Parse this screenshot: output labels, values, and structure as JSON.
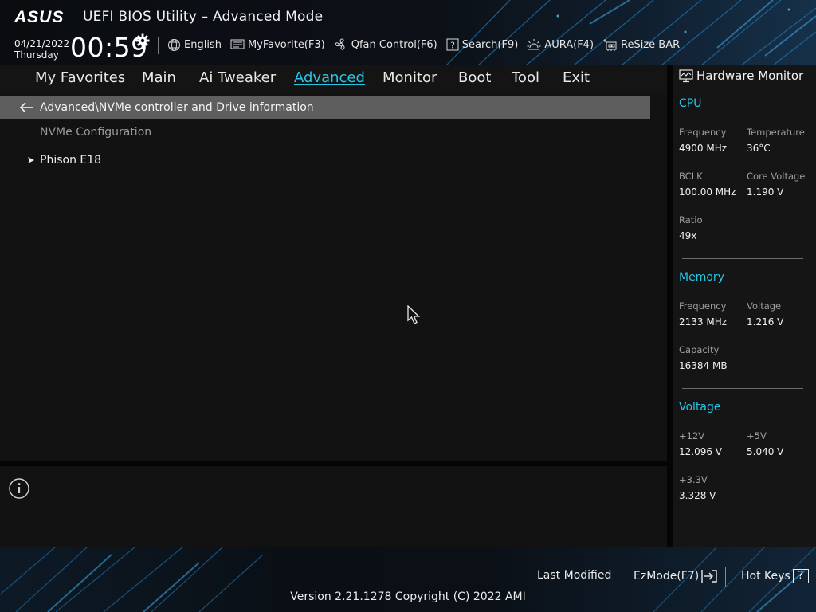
{
  "header": {
    "brand": "ASUS",
    "title": "UEFI BIOS Utility – Advanced Mode",
    "date": "04/21/2022",
    "day": "Thursday",
    "time": "00:59",
    "icons": {
      "settings": "gear-icon"
    }
  },
  "toolbar": {
    "items": [
      {
        "label": "English",
        "icon": "globe-icon"
      },
      {
        "label": "MyFavorite(F3)",
        "icon": "favorite-icon"
      },
      {
        "label": "Qfan Control(F6)",
        "icon": "fan-icon"
      },
      {
        "label": "Search(F9)",
        "icon": "search-help-icon"
      },
      {
        "label": "AURA(F4)",
        "icon": "aura-icon"
      },
      {
        "label": "ReSize BAR",
        "icon": "resize-bar-icon"
      }
    ]
  },
  "menu": {
    "items": [
      "My Favorites",
      "Main",
      "Ai Tweaker",
      "Advanced",
      "Monitor",
      "Boot",
      "Tool",
      "Exit"
    ],
    "active": "Advanced"
  },
  "main": {
    "path": "Advanced\\NVMe controller and Drive information",
    "section_label": "NVMe Configuration",
    "items": [
      {
        "label": "Phison E18"
      }
    ]
  },
  "hardware_monitor": {
    "title": "Hardware Monitor",
    "cpu": {
      "title": "CPU",
      "frequency_label": "Frequency",
      "frequency": "4900 MHz",
      "temperature_label": "Temperature",
      "temperature": "36°C",
      "bclk_label": "BCLK",
      "bclk": "100.00 MHz",
      "core_voltage_label": "Core Voltage",
      "core_voltage": "1.190 V",
      "ratio_label": "Ratio",
      "ratio": "49x"
    },
    "memory": {
      "title": "Memory",
      "frequency_label": "Frequency",
      "frequency": "2133 MHz",
      "voltage_label": "Voltage",
      "voltage": "1.216 V",
      "capacity_label": "Capacity",
      "capacity": "16384 MB"
    },
    "voltage": {
      "title": "Voltage",
      "v12_label": "+12V",
      "v12": "12.096 V",
      "v5_label": "+5V",
      "v5": "5.040 V",
      "v33_label": "+3.3V",
      "v33": "3.328 V"
    }
  },
  "footer": {
    "last_modified": "Last Modified",
    "ezmode": "EzMode(F7)",
    "hotkeys": "Hot Keys",
    "hotkeys_badge": "?",
    "version": "Version 2.21.1278 Copyright (C) 2022 AMI"
  },
  "colors": {
    "accent": "#27c6e6",
    "path_bar": "#5e5e5e",
    "panel": "#121212"
  }
}
